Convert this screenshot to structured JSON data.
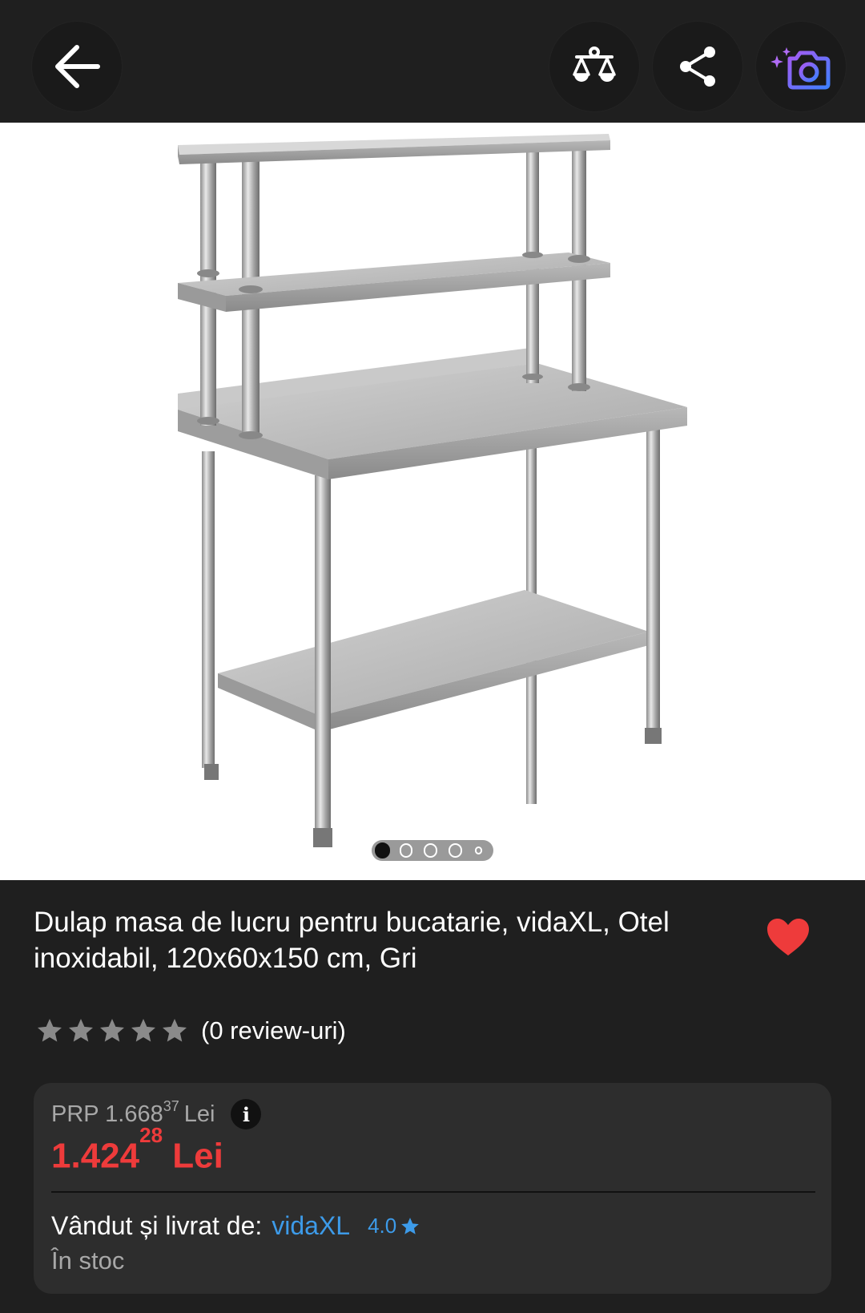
{
  "topbar": {
    "back_icon": "arrow-left-icon",
    "compare_icon": "scale-icon",
    "share_icon": "share-icon",
    "camera_icon": "camera-search-icon"
  },
  "gallery": {
    "image_alt": "Dulap masa de lucru pentru bucatarie, vidaXL, Otel inoxidabil, 120x60x150 cm, Gri",
    "pages": 5,
    "active_page": 1
  },
  "product": {
    "title": "Dulap masa de lucru pentru bucatarie, vidaXL, Otel inoxidabil, 120x60x150 cm, Gri",
    "favorite_icon": "heart-icon",
    "rating_stars": 5,
    "rating_value": 0,
    "reviews_label": "(0 review-uri)"
  },
  "pricing": {
    "prp_prefix": "PRP 1.668",
    "prp_decimals": "37",
    "prp_currency": "Lei",
    "info_label": "i",
    "price_main": "1.424",
    "price_decimals": "28",
    "price_currency": "Lei",
    "seller_label": "Vândut și livrat de:",
    "seller_name": "vidaXL",
    "seller_rating": "4.0",
    "stock_label": "În stoc"
  },
  "colors": {
    "background": "#1f1f1f",
    "card": "#2d2d2d",
    "price_red": "#ee3b3b",
    "link_blue": "#3d9be9",
    "heart_red": "#ee3b3b"
  }
}
